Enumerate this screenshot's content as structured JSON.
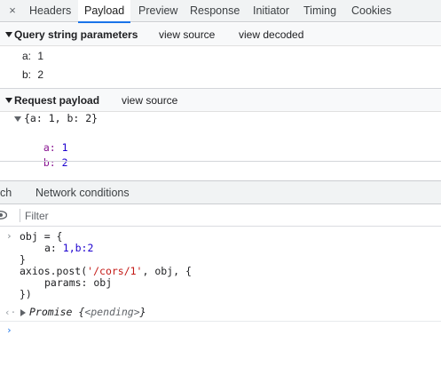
{
  "tabs": {
    "close_symbol": "×",
    "items": [
      "Headers",
      "Payload",
      "Preview",
      "Response",
      "Initiator",
      "Timing",
      "Cookies"
    ],
    "active": "Payload"
  },
  "query": {
    "title": "Query string parameters",
    "view_source": "view source",
    "view_decoded": "view decoded",
    "params": [
      {
        "key": "a:",
        "value": "1"
      },
      {
        "key": "b:",
        "value": "2"
      }
    ]
  },
  "payload": {
    "title": "Request payload",
    "view_source": "view source",
    "summary": "{a: 1, b: 2}",
    "props": [
      {
        "key": "a:",
        "value": "1"
      },
      {
        "key": "b:",
        "value": "2"
      }
    ]
  },
  "drawer": {
    "tabs": [
      "ch",
      "Network conditions"
    ]
  },
  "console": {
    "filter_placeholder": "Filter",
    "input_chevron": "›",
    "code": {
      "l1": "obj = {",
      "l2_key": "a: ",
      "l2_val": "1,b:2",
      "l3": "}",
      "l4_pre": "axios.post(",
      "l4_str": "'/cors/1'",
      "l4_post": ", obj, {",
      "l5": "params: obj",
      "l6": "})"
    },
    "result": {
      "chevron": "‹·",
      "label": "Promise",
      "open": " {",
      "state": "<pending>",
      "close": "}"
    },
    "prompt": "›"
  },
  "colors": {
    "accent": "#1a73e8",
    "property_purple": "#881391",
    "number_blue": "#1c00cf",
    "string_red": "#c41a16"
  }
}
